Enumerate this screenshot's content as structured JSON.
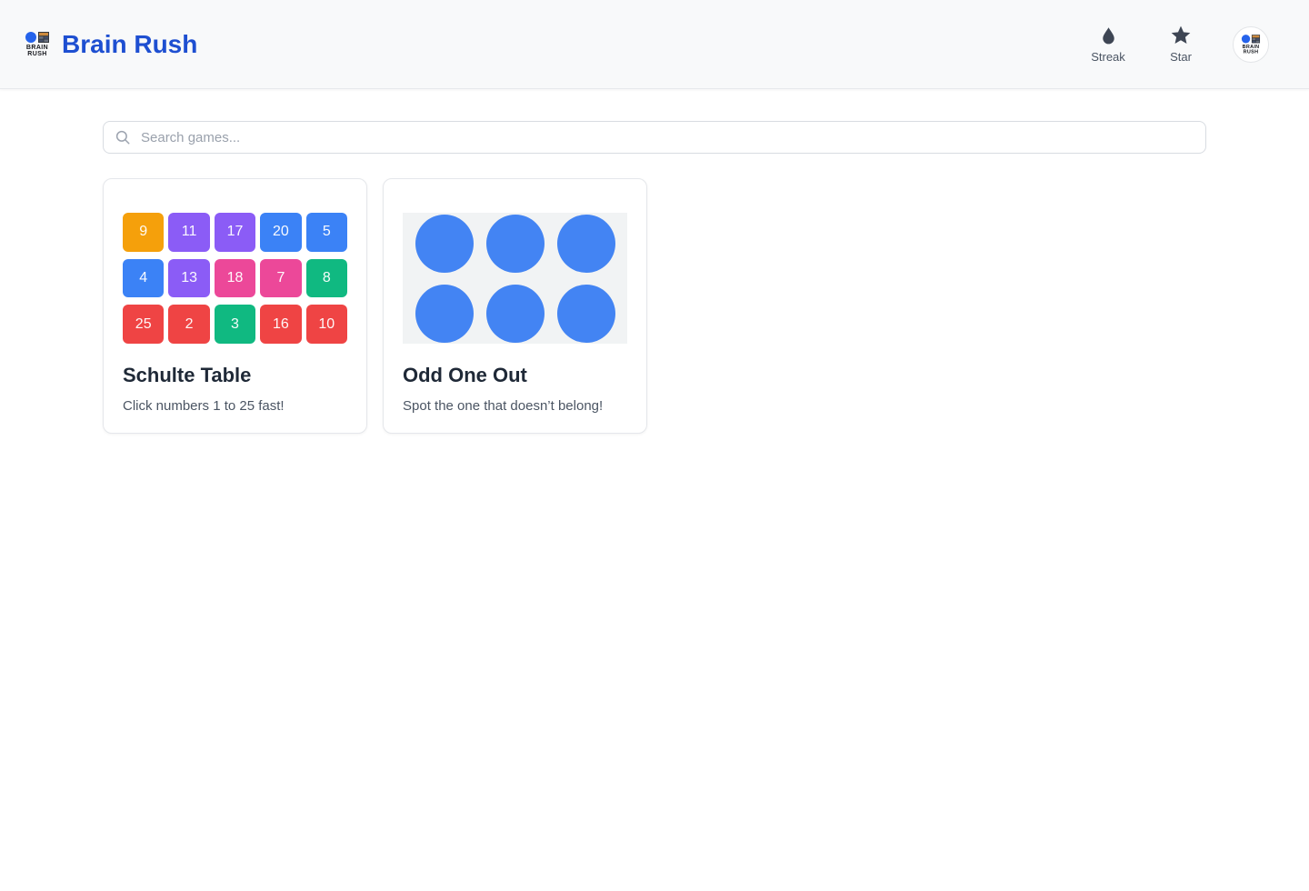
{
  "header": {
    "app_title": "Brain Rush",
    "logo_text_line1": "BRAIN",
    "logo_text_line2": "RUSH",
    "actions": [
      {
        "id": "streak",
        "label": "Streak",
        "icon": "flame-drop-icon"
      },
      {
        "id": "star",
        "label": "Star",
        "icon": "star-icon"
      }
    ]
  },
  "search": {
    "placeholder": "Search games...",
    "value": "",
    "icon": "search-icon"
  },
  "games": [
    {
      "title": "Schulte Table",
      "subtitle": "Click numbers 1 to 25 fast!",
      "preview": {
        "type": "number-grid",
        "columns": 5,
        "rows": 3,
        "tiles": [
          {
            "n": "9",
            "color": "#F5A00B"
          },
          {
            "n": "11",
            "color": "#8B5CF6"
          },
          {
            "n": "17",
            "color": "#8B5CF6"
          },
          {
            "n": "20",
            "color": "#3B82F6"
          },
          {
            "n": "5",
            "color": "#3B82F6"
          },
          {
            "n": "4",
            "color": "#3B82F6"
          },
          {
            "n": "13",
            "color": "#8B5CF6"
          },
          {
            "n": "18",
            "color": "#EC4899"
          },
          {
            "n": "7",
            "color": "#EC4899"
          },
          {
            "n": "8",
            "color": "#10B981"
          },
          {
            "n": "25",
            "color": "#EF4444"
          },
          {
            "n": "2",
            "color": "#EF4444"
          },
          {
            "n": "3",
            "color": "#10B981"
          },
          {
            "n": "16",
            "color": "#EF4444"
          },
          {
            "n": "10",
            "color": "#EF4444"
          }
        ]
      }
    },
    {
      "title": "Odd One Out",
      "subtitle": "Spot the one that doesn’t belong!",
      "preview": {
        "type": "circle-grid",
        "rows": 2,
        "columns": 3,
        "circle_color": "#4384F3",
        "panel_color": "#F1F3F4"
      }
    }
  ],
  "colors": {
    "brand_blue": "#1E4FD1",
    "header_bg": "#F8F9FA",
    "icon_slate": "#3E4654",
    "title_text": "#1F2937",
    "subtitle_text": "#4B5563"
  }
}
